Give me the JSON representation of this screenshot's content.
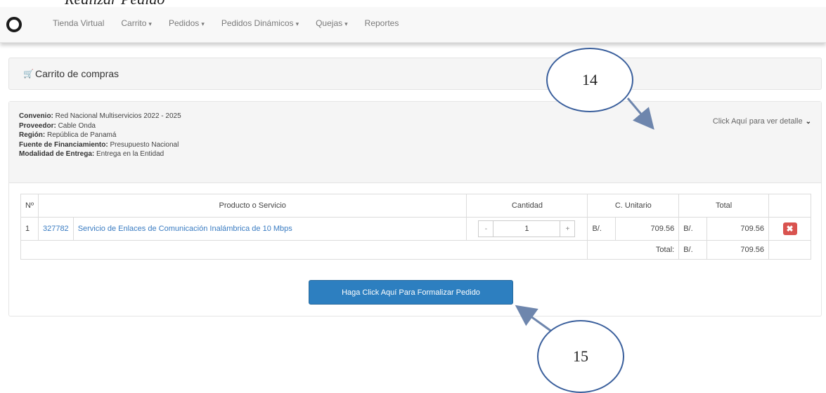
{
  "top_text": "Realizar Pedido",
  "navbar": {
    "items": [
      {
        "label": "Tienda Virtual",
        "caret": false
      },
      {
        "label": "Carrito",
        "caret": true
      },
      {
        "label": "Pedidos",
        "caret": true
      },
      {
        "label": "Pedidos Dinámicos",
        "caret": true
      },
      {
        "label": "Quejas",
        "caret": true
      },
      {
        "label": "Reportes",
        "caret": false
      }
    ]
  },
  "panel": {
    "title": "Carrito de compras"
  },
  "info": {
    "convenio_label": "Convenio:",
    "convenio": "Red Nacional Multiservicios 2022 - 2025",
    "proveedor_label": "Proveedor:",
    "proveedor": "Cable Onda",
    "region_label": "Región:",
    "region": "República de Panamá",
    "fuente_label": "Fuente de Financiamiento:",
    "fuente": "Presupuesto Nacional",
    "modalidad_label": "Modalidad de Entrega:",
    "modalidad": "Entrega en la Entidad",
    "details_link": "Click Aquí para ver detalle"
  },
  "table": {
    "headers": {
      "num": "Nº",
      "product": "Producto o Servicio",
      "qty": "Cantidad",
      "unit": "C. Unitario",
      "total": "Total"
    },
    "rows": [
      {
        "num": "1",
        "code": "327782",
        "product": "Servicio de Enlaces de Comunicación Inalámbrica de 10 Mbps",
        "minus": "-",
        "qty": "1",
        "plus": "+",
        "currency": "B/.",
        "unit_price": "709.56",
        "total_currency": "B/.",
        "total": "709.56"
      }
    ],
    "footer": {
      "label": "Total:",
      "currency": "B/.",
      "amount": "709.56"
    }
  },
  "submit_label": "Haga Click Aquí Para Formalizar Pedido",
  "callouts": {
    "first": "14",
    "second": "15"
  }
}
